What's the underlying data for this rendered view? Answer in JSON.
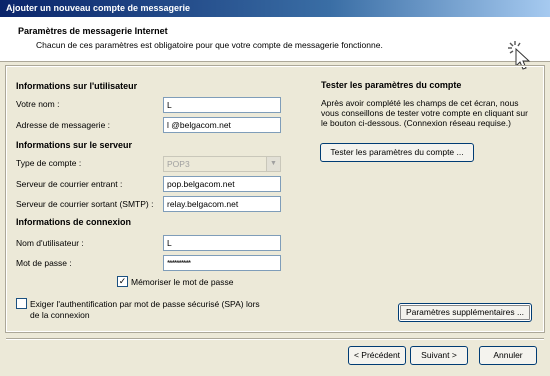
{
  "window": {
    "title": "Ajouter un nouveau compte de messagerie"
  },
  "header": {
    "title": "Paramètres de messagerie Internet",
    "subtitle": "Chacun de ces paramètres est obligatoire pour que votre compte de messagerie fonctionne.",
    "icon": "wizard-cursor-icon"
  },
  "user_info": {
    "heading": "Informations sur l'utilisateur",
    "name_label": "Votre nom :",
    "name_value": "L",
    "email_label": "Adresse de messagerie :",
    "email_value": "l                  @belgacom.net"
  },
  "server_info": {
    "heading": "Informations sur le serveur",
    "account_type_label": "Type de compte :",
    "account_type_value": "POP3",
    "incoming_label": "Serveur de courrier entrant :",
    "incoming_value": "pop.belgacom.net",
    "outgoing_label": "Serveur de courrier sortant (SMTP) :",
    "outgoing_value": "relay.belgacom.net"
  },
  "login_info": {
    "heading": "Informations de connexion",
    "username_label": "Nom d'utilisateur :",
    "username_value": "L",
    "password_label": "Mot de passe :",
    "password_value": "**********",
    "remember_label": "Mémoriser le mot de passe",
    "remember_checked": true,
    "spa_label_line1": "Exiger l'authentification par mot de passe sécurisé (SPA) lors",
    "spa_label_line2": "de la connexion",
    "spa_checked": false
  },
  "test": {
    "heading": "Tester les paramètres du compte",
    "description": "Après avoir complété les champs de cet écran, nous vous conseillons de tester votre compte en cliquant sur le bouton ci-dessous. (Connexion réseau requise.)",
    "button_label": "Tester les paramètres du compte ..."
  },
  "more_settings": {
    "label": "Paramètres supplémentaires ..."
  },
  "footer": {
    "back_label": "< Précédent",
    "next_label": "Suivant >",
    "cancel_label": "Annuler"
  }
}
